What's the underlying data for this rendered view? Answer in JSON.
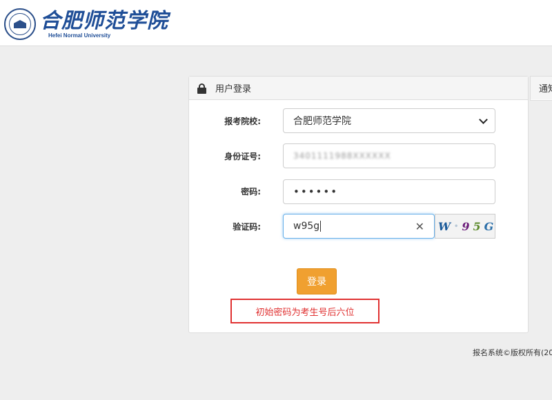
{
  "header": {
    "logo_cn": "合肥师范学院",
    "logo_en": "Hefei Normal University"
  },
  "login": {
    "title": "用户登录",
    "school_label": "报考院校:",
    "school_value": "合肥师范学院",
    "id_label": "身份证号:",
    "id_value": "3401111988XXXXXX",
    "password_label": "密码:",
    "password_value": "••••••",
    "captcha_label": "验证码:",
    "captcha_value": "w95g",
    "captcha_image_chars": [
      "W",
      "•",
      "9",
      "5",
      "G"
    ],
    "login_button": "登录",
    "hint": "初始密码为考生号后六位"
  },
  "notice": {
    "title": "通知"
  },
  "footer": {
    "text": "报名系统©版权所有(20"
  },
  "colors": {
    "brand": "#1f4e97",
    "button": "#f0a030",
    "hint": "#e03030",
    "focus": "#66afe9"
  },
  "icons": [
    "lock-icon",
    "chevron-down-icon",
    "clear-icon"
  ]
}
